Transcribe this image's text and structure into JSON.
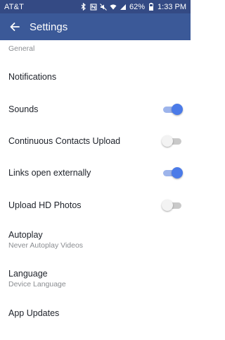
{
  "status_bar": {
    "carrier": "AT&T",
    "battery": "62%",
    "time": "1:33 PM",
    "icons": [
      "bluetooth-icon",
      "nfc-icon",
      "mute-icon",
      "wifi-icon",
      "signal-icon",
      "battery-icon"
    ]
  },
  "app_bar": {
    "title": "Settings",
    "back_icon": "arrow-left-icon",
    "color": "#3b5998"
  },
  "settings": {
    "section": "General",
    "notifications": "Notifications",
    "sounds": {
      "label": "Sounds",
      "enabled": true
    },
    "contacts_upload": {
      "label": "Continuous Contacts Upload",
      "enabled": false
    },
    "links_external": {
      "label": "Links open externally",
      "enabled": true
    },
    "upload_hd": {
      "label": "Upload HD Photos",
      "enabled": false
    },
    "autoplay": {
      "label": "Autoplay",
      "value": "Never Autoplay Videos"
    },
    "language": {
      "label": "Language",
      "value": "Device Language"
    },
    "app_updates": "App Updates"
  },
  "colors": {
    "toggle_on": "#4b7be8",
    "toggle_off": "#f3f3f3"
  }
}
